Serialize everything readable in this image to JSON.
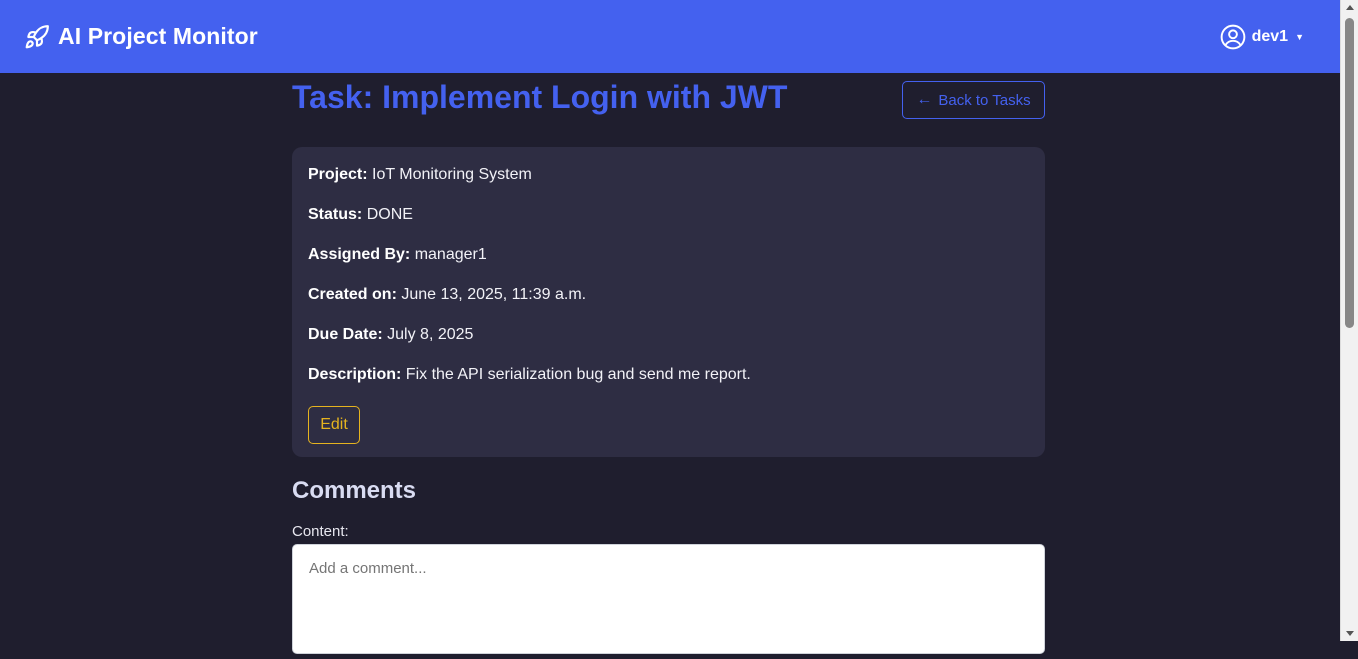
{
  "navbar": {
    "brand_text": "AI Project Monitor",
    "brand_icon": "rocket-icon",
    "user_name": "dev1",
    "user_icon": "user-circle-icon",
    "accent_color": "#4461ef"
  },
  "header": {
    "title": "Task: Implement Login with JWT",
    "back_button_label": "Back to Tasks",
    "back_icon": "arrow-left-icon"
  },
  "task": {
    "project_label": "Project:",
    "project": "IoT Monitoring System",
    "status_label": "Status:",
    "status": "DONE",
    "assigned_by_label": "Assigned By:",
    "assigned_by": "manager1",
    "created_label": "Created on:",
    "created": "June 13, 2025, 11:39 a.m.",
    "due_label": "Due Date:",
    "due": "July 8, 2025",
    "description_label": "Description:",
    "description": "Fix the API serialization bug and send me report.",
    "edit_label": "Edit",
    "edit_color": "#e5b31f"
  },
  "comments": {
    "heading": "Comments",
    "content_label": "Content:",
    "placeholder": "Add a comment..."
  }
}
